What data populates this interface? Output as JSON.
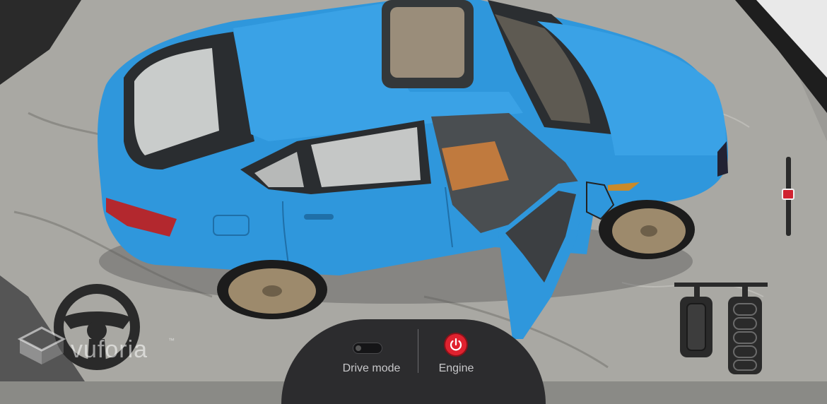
{
  "controls": {
    "drive_mode_label": "Drive mode",
    "engine_label": "Engine",
    "drive_mode_on": false
  },
  "branding": {
    "watermark_text": "vuforia",
    "watermark_mark": "™"
  },
  "colors": {
    "car_body": "#2f97dc",
    "panel_bg": "#2c2c2e",
    "engine_button": "#e0222f",
    "slider_thumb": "#d02230"
  },
  "icons": [
    "steering-wheel-icon",
    "pedals-icon",
    "power-icon",
    "vuforia-logo-icon"
  ]
}
